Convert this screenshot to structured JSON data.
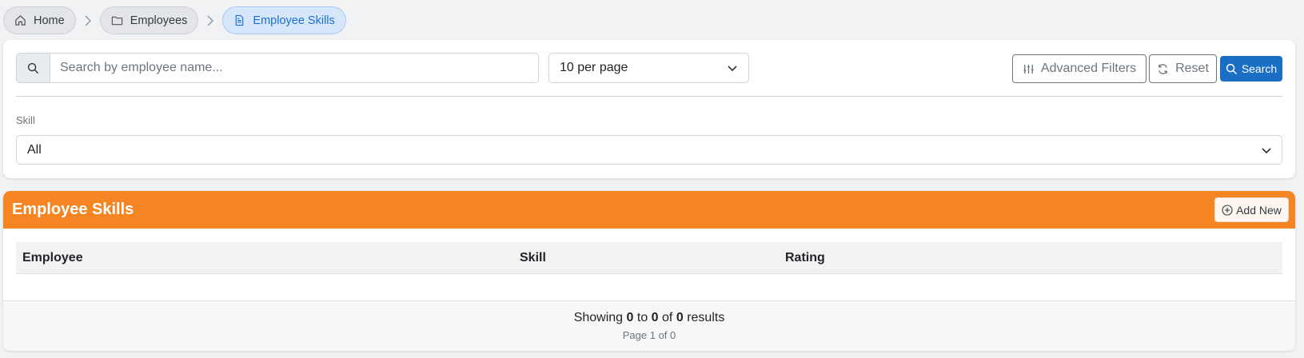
{
  "breadcrumb": {
    "items": [
      {
        "label": "Home",
        "icon": "home-icon"
      },
      {
        "label": "Employees",
        "icon": "folder-icon"
      },
      {
        "label": "Employee Skills",
        "icon": "document-icon"
      }
    ]
  },
  "filters": {
    "search_placeholder": "Search by employee name...",
    "search_value": "",
    "per_page": "10 per page",
    "advanced_filters_label": "Advanced Filters",
    "reset_label": "Reset",
    "search_label": "Search",
    "skill_label": "Skill",
    "skill_value": "All"
  },
  "table": {
    "title": "Employee Skills",
    "add_new_label": "Add New",
    "columns": [
      "Employee",
      "Skill",
      "Rating"
    ],
    "rows": [],
    "footer": {
      "showing_prefix": "Showing",
      "from": "0",
      "to_word": "to",
      "to": "0",
      "of_word": "of",
      "total": "0",
      "results_word": "results",
      "page_info": "Page 1 of 0"
    }
  },
  "colors": {
    "header_orange": "#f58522",
    "primary_blue": "#1a6fc4",
    "active_crumb_text": "#1a6fd6"
  }
}
